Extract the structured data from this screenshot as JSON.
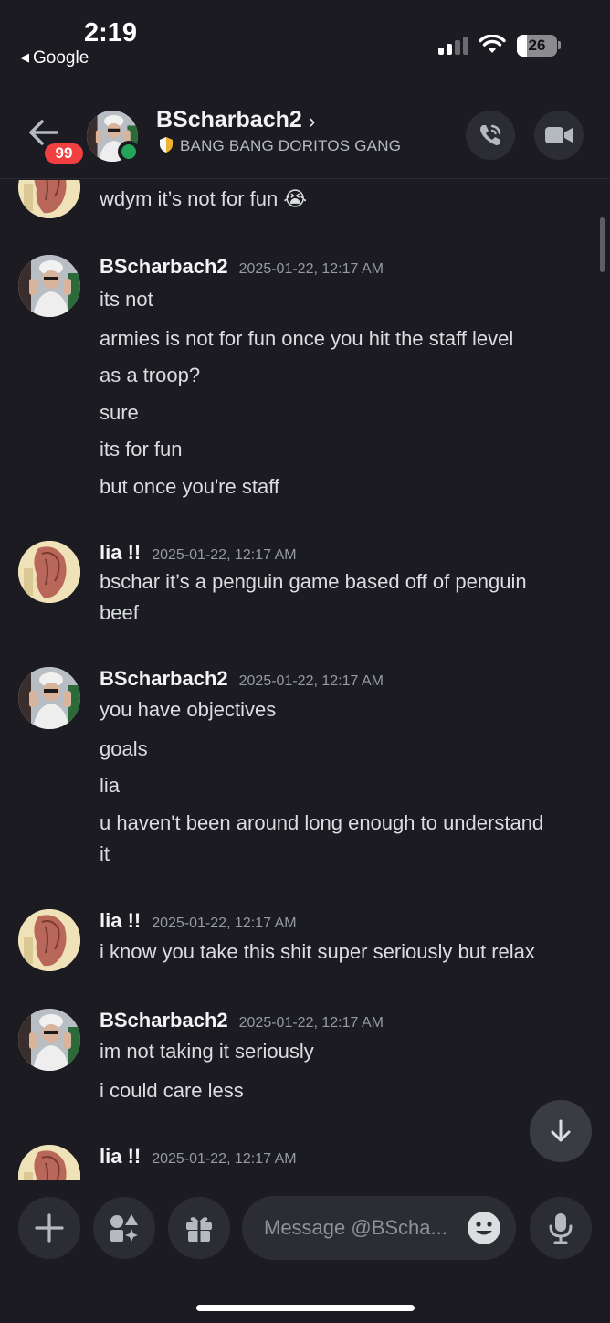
{
  "status": {
    "time": "2:19",
    "back_app": "Google",
    "battery": "26",
    "battery_level": 0.26
  },
  "header": {
    "unread_badge": "99",
    "name": "BScharbach2",
    "server": "BANG BANG DORITOS GANG",
    "icons": [
      "back-arrow-icon",
      "phone-icon",
      "video-camera-icon"
    ]
  },
  "messages": [
    {
      "lines": [
        "wdym it’s not for fun 😭"
      ]
    },
    {
      "author": "BScharbach2",
      "time": "2025-01-22, 12:17 AM",
      "lines": [
        "its not",
        "armies is not for fun once you hit the staff level",
        "as a troop?",
        "sure",
        "its for fun",
        "but once you're staff"
      ]
    },
    {
      "author": "lia !!",
      "time": "2025-01-22, 12:17 AM",
      "lines": [
        "bschar it’s a penguin game based off of penguin",
        "beef"
      ]
    },
    {
      "author": "BScharbach2",
      "time": "2025-01-22, 12:17 AM",
      "lines": [
        "you have objectives",
        "goals",
        "lia",
        "u haven't been around long enough to understand",
        "it"
      ]
    },
    {
      "author": "lia !!",
      "time": "2025-01-22, 12:17 AM",
      "lines": [
        "i know you take this shit super seriously but relax"
      ]
    },
    {
      "author": "BScharbach2",
      "time": "2025-01-22, 12:17 AM",
      "lines": [
        "im not taking it seriously",
        "i could care less"
      ]
    },
    {
      "author": "lia !!",
      "time": "2025-01-22, 12:17 AM",
      "lines": []
    }
  ],
  "composer": {
    "placeholder": "Message @BScha...",
    "icons": [
      "plus-icon",
      "apps-icon",
      "gift-icon",
      "emoji-icon",
      "microphone-icon"
    ]
  },
  "colors": {
    "background": "#1b1b21",
    "badge": "#f23f42",
    "online": "#23a55a"
  }
}
